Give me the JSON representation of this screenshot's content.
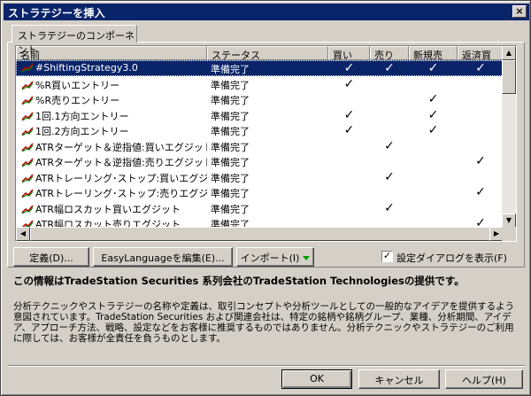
{
  "window": {
    "title": "ストラテジーを挿入",
    "close_glyph": "×"
  },
  "tab": {
    "label": "ストラテジーのコンポーネント"
  },
  "table": {
    "columns": [
      "名前",
      "ステータス",
      "買い",
      "売り",
      "新規売",
      "返済買"
    ],
    "rows": [
      {
        "name": "#ShiftingStrategy3.0",
        "status": "準備完了",
        "buy": "✓",
        "sell": "✓",
        "newpos": "✓",
        "exit": "✓",
        "selected": true
      },
      {
        "name": "%R買いエントリー",
        "status": "準備完了",
        "buy": "✓",
        "sell": "",
        "newpos": "",
        "exit": ""
      },
      {
        "name": "%R売りエントリー",
        "status": "準備完了",
        "buy": "",
        "sell": "",
        "newpos": "✓",
        "exit": ""
      },
      {
        "name": "1回.1方向エントリー",
        "status": "準備完了",
        "buy": "✓",
        "sell": "",
        "newpos": "✓",
        "exit": ""
      },
      {
        "name": "1回.2方向エントリー",
        "status": "準備完了",
        "buy": "✓",
        "sell": "",
        "newpos": "✓",
        "exit": ""
      },
      {
        "name": "ATRターゲット＆逆指値:買いエグジット",
        "status": "準備完了",
        "buy": "",
        "sell": "✓",
        "newpos": "",
        "exit": ""
      },
      {
        "name": "ATRターゲット＆逆指値:売りエグジット",
        "status": "準備完了",
        "buy": "",
        "sell": "",
        "newpos": "",
        "exit": "✓"
      },
      {
        "name": "ATRトレーリング･ストップ:買いエグジット",
        "status": "準備完了",
        "buy": "",
        "sell": "✓",
        "newpos": "",
        "exit": ""
      },
      {
        "name": "ATRトレーリング･ストップ:売りエグジット",
        "status": "準備完了",
        "buy": "",
        "sell": "",
        "newpos": "",
        "exit": "✓"
      },
      {
        "name": "ATR幅ロスカット買いエグジット",
        "status": "準備完了",
        "buy": "",
        "sell": "✓",
        "newpos": "",
        "exit": ""
      },
      {
        "name": "ATR幅ロスカット売りエグジット",
        "status": "準備完了",
        "buy": "",
        "sell": "",
        "newpos": "",
        "exit": "✓"
      }
    ]
  },
  "buttons": {
    "define": "定義(D)...",
    "edit_el": "EasyLanguageを編集(E)...",
    "import": "インポート(I)",
    "ok": "OK",
    "cancel": "キャンセル",
    "help": "ヘルプ(H)"
  },
  "show_settings": {
    "label": "設定ダイアログを表示(F)",
    "checked": true,
    "check_glyph": "✓"
  },
  "notice": "この情報はTradeStation Securities 系列会社のTradeStation Technologiesの提供です。",
  "disclaimer": "分析テクニックやストラテジーの名称や定義は、取引コンセプトや分析ツールとしての一般的なアイデアを提供するよう意図されています。TradeStation Securities および関連会社は、特定の銘柄や銘柄グループ、業種、分析期間、アイデア、アプローチ方法、戦略、設定などをお客様に推奨するものではありません。分析テクニックやストラテジーのご利用に際しては、お客様が全責任を負うものとします。",
  "colors": {
    "title_bar": "#0a246a",
    "selection": "#0a246a",
    "dialog_bg": "#d4d0c8",
    "dropdown_arrow": "#00a000"
  }
}
